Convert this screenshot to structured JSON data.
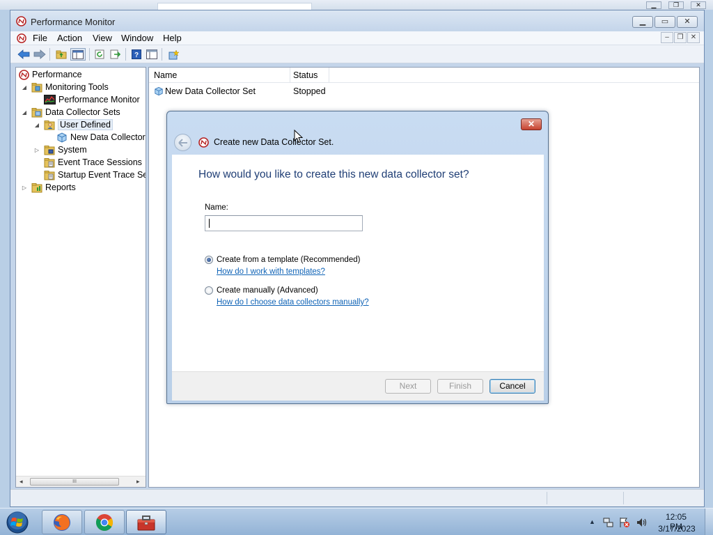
{
  "window": {
    "title": "Performance Monitor",
    "controls": {
      "minimize": "▁",
      "maximize": "▭",
      "close": "✕"
    }
  },
  "background_controls": {
    "minimize": "▁",
    "restore": "❐",
    "close": "✕"
  },
  "menu": [
    "File",
    "Action",
    "View",
    "Window",
    "Help"
  ],
  "mdi_controls": {
    "minimize": "–",
    "restore": "❐",
    "close": "✕"
  },
  "toolbar": [
    "back-icon",
    "forward-icon",
    "up-folder-icon",
    "show-hide-tree-icon",
    "refresh-icon",
    "export-list-icon",
    "help-icon",
    "properties-icon",
    "new-icon"
  ],
  "tree": {
    "items": [
      {
        "label": "Performance",
        "icon": "perfmon-icon",
        "expander": ""
      },
      {
        "label": "Monitoring Tools",
        "icon": "folder-icon",
        "expander": "◢"
      },
      {
        "label": "Performance Monitor",
        "icon": "chart-icon",
        "expander": ""
      },
      {
        "label": "Data Collector Sets",
        "icon": "collector-sets-icon",
        "expander": "◢"
      },
      {
        "label": "User Defined",
        "icon": "user-folder-icon",
        "expander": "◢"
      },
      {
        "label": "New Data Collector",
        "icon": "collector-icon",
        "expander": ""
      },
      {
        "label": "System",
        "icon": "system-folder-icon",
        "expander": "▷"
      },
      {
        "label": "Event Trace Sessions",
        "icon": "trace-icon",
        "expander": ""
      },
      {
        "label": "Startup Event Trace Ses",
        "icon": "trace-icon",
        "expander": ""
      },
      {
        "label": "Reports",
        "icon": "reports-icon",
        "expander": "▷"
      }
    ],
    "scroll_thumb": "III"
  },
  "list": {
    "columns": [
      "Name",
      "Status"
    ],
    "rows": [
      {
        "name": "New Data Collector Set",
        "status": "Stopped"
      }
    ]
  },
  "dialog": {
    "title": "Create new Data Collector Set.",
    "close_label": "✕",
    "question": "How would you like to create this new data collector set?",
    "name_label": "Name:",
    "name_value": "",
    "option_template": "Create from a template (Recommended)",
    "link_template": "How do I work with templates?",
    "option_manual": "Create manually (Advanced)",
    "link_manual": "How do I choose data collectors manually?",
    "selected_option": "template",
    "buttons": {
      "next": "Next",
      "finish": "Finish",
      "cancel": "Cancel"
    }
  },
  "taskbar": {
    "apps": [
      "firefox-icon",
      "chrome-icon",
      "toolbox-icon"
    ],
    "tray_icons": [
      "show-hidden-icons-arrow",
      "network-icon",
      "action-center-icon",
      "volume-icon"
    ],
    "time": "12:05 PM",
    "date": "3/17/2023"
  },
  "colors": {
    "dialog_heading": "#1f3e75",
    "link": "#0f63b6",
    "close_red": "#c6432f",
    "window_frame": "#c4d5ea"
  }
}
